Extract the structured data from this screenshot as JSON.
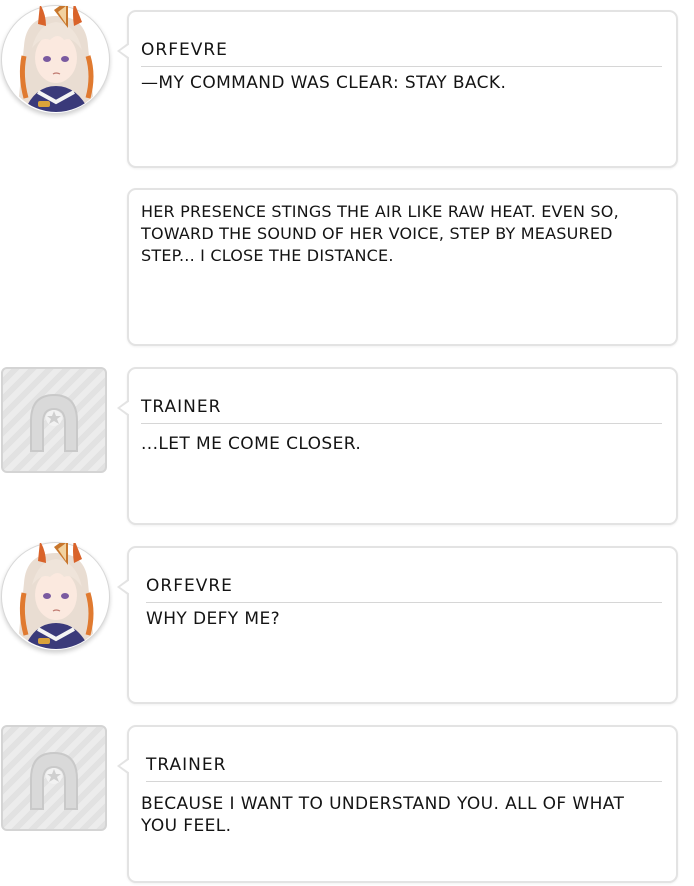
{
  "dialogue": [
    {
      "type": "speech",
      "avatar": "orfevre-portrait",
      "speaker": "Orfevre",
      "text": "—My command was clear: stay back."
    },
    {
      "type": "narration",
      "text": "Her presence stings the air like raw heat. Even so, toward the sound of her voice, step by measured step... I close the distance."
    },
    {
      "type": "speech",
      "avatar": "trainer-horseshoe-placeholder",
      "speaker": "Trainer",
      "text": "...Let me come closer."
    },
    {
      "type": "speech",
      "avatar": "orfevre-portrait",
      "speaker": "Orfevre",
      "text": "Why defy me?"
    },
    {
      "type": "speech",
      "avatar": "trainer-horseshoe-placeholder",
      "speaker": "Trainer",
      "text": "Because I want to understand you. All of what you feel."
    }
  ]
}
